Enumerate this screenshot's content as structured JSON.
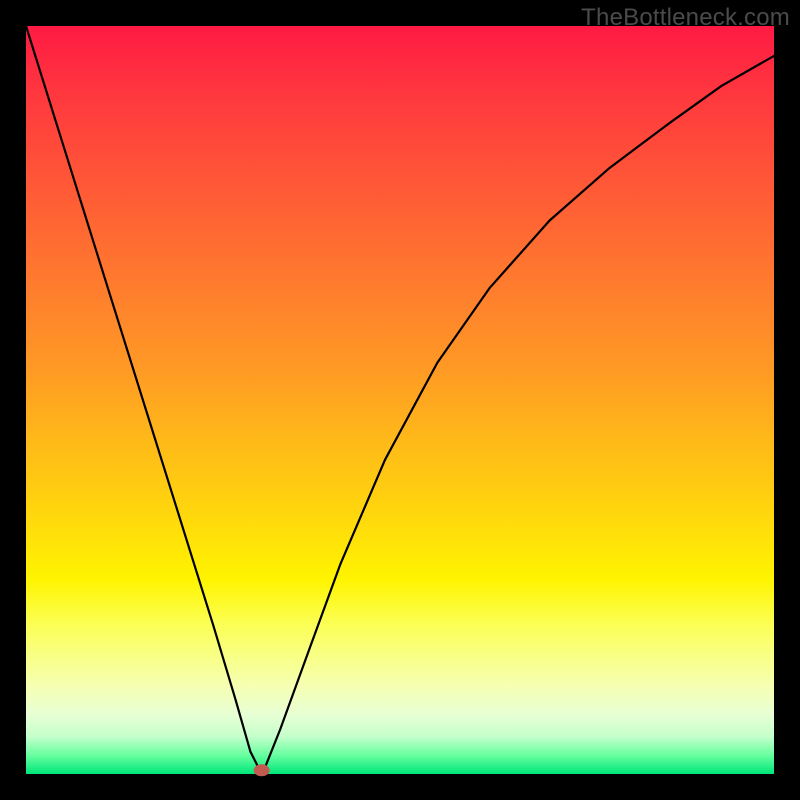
{
  "watermark": "TheBottleneck.com",
  "chart_data": {
    "type": "line",
    "title": "",
    "xlabel": "",
    "ylabel": "",
    "xlim": [
      0,
      100
    ],
    "ylim": [
      0,
      100
    ],
    "grid": false,
    "legend": false,
    "series": [
      {
        "name": "bottleneck-curve",
        "x": [
          0,
          5,
          10,
          15,
          20,
          25,
          28,
          30,
          31,
          31.5,
          32,
          34,
          38,
          42,
          48,
          55,
          62,
          70,
          78,
          86,
          93,
          100
        ],
        "y": [
          100,
          84,
          68,
          52,
          36,
          20,
          10,
          3,
          1,
          0,
          1,
          6,
          17,
          28,
          42,
          55,
          65,
          74,
          81,
          87,
          92,
          96
        ]
      }
    ],
    "annotations": [
      {
        "name": "marker",
        "x": 31.5,
        "y": 0.5,
        "shape": "oval",
        "color": "#c25a52"
      }
    ],
    "background_gradient": {
      "direction": "vertical",
      "stops": [
        {
          "pos": 0.0,
          "color": "#ff1a43"
        },
        {
          "pos": 0.5,
          "color": "#ffbb18"
        },
        {
          "pos": 0.74,
          "color": "#fff400"
        },
        {
          "pos": 0.92,
          "color": "#e8ffd4"
        },
        {
          "pos": 1.0,
          "color": "#00e67a"
        }
      ]
    }
  }
}
